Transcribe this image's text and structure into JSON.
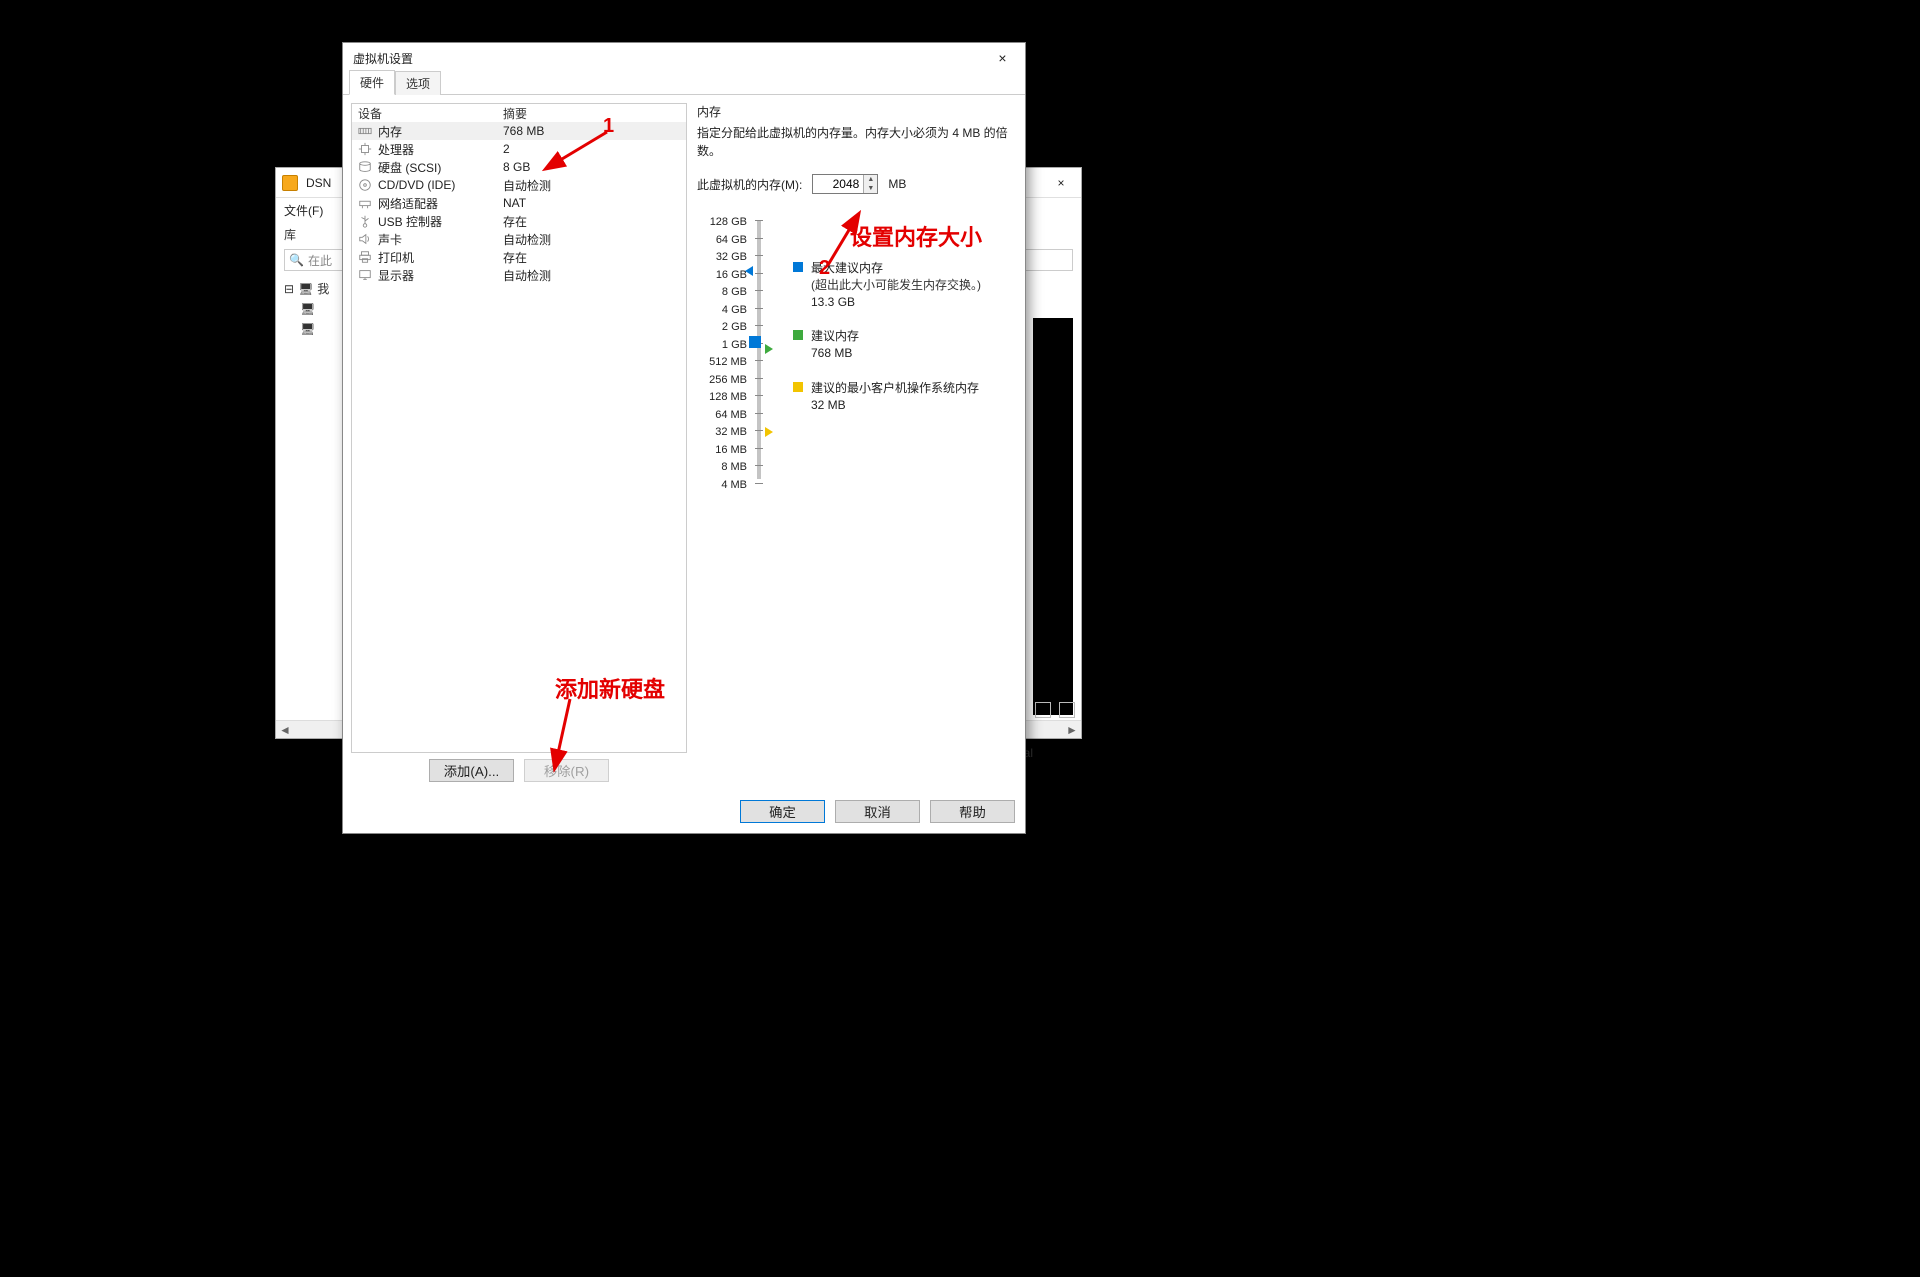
{
  "bg": {
    "title": "DSN",
    "file_menu": "文件(F)",
    "library_label": "库",
    "search_placeholder": "在此",
    "tree_root": "我",
    "al_text": "al",
    "win_minimize": "—",
    "win_maximize": "□",
    "win_close": "×"
  },
  "dialog": {
    "title": "虚拟机设置",
    "close": "×",
    "tabs": {
      "hardware": "硬件",
      "options": "选项"
    },
    "columns": {
      "device": "设备",
      "summary": "摘要"
    },
    "devices": [
      {
        "icon": "memory-icon",
        "name": "内存",
        "summary": "768 MB",
        "selected": true
      },
      {
        "icon": "cpu-icon",
        "name": "处理器",
        "summary": "2"
      },
      {
        "icon": "hdd-icon",
        "name": "硬盘 (SCSI)",
        "summary": "8 GB"
      },
      {
        "icon": "cd-icon",
        "name": "CD/DVD (IDE)",
        "summary": "自动检测"
      },
      {
        "icon": "net-icon",
        "name": "网络适配器",
        "summary": "NAT"
      },
      {
        "icon": "usb-icon",
        "name": "USB 控制器",
        "summary": "存在"
      },
      {
        "icon": "sound-icon",
        "name": "声卡",
        "summary": "自动检测"
      },
      {
        "icon": "printer-icon",
        "name": "打印机",
        "summary": "存在"
      },
      {
        "icon": "display-icon",
        "name": "显示器",
        "summary": "自动检测"
      }
    ],
    "add_btn": "添加(A)...",
    "remove_btn": "移除(R)",
    "ok_btn": "确定",
    "cancel_btn": "取消",
    "help_btn": "帮助"
  },
  "memory": {
    "section_title": "内存",
    "desc": "指定分配给此虚拟机的内存量。内存大小必须为 4 MB 的倍数。",
    "label": "此虚拟机的内存(M):",
    "value": "2048",
    "unit": "MB",
    "ticks": [
      "128 GB",
      "64 GB",
      "32 GB",
      "16 GB",
      "8 GB",
      "4 GB",
      "2 GB",
      "1 GB",
      "512 MB",
      "256 MB",
      "128 MB",
      "64 MB",
      "32 MB",
      "16 MB",
      "8 MB",
      "4 MB"
    ],
    "legend": {
      "max": {
        "title": "最大建议内存",
        "note": "(超出此大小可能发生内存交换。)",
        "value": "13.3 GB"
      },
      "rec": {
        "title": "建议内存",
        "value": "768 MB"
      },
      "min": {
        "title": "建议的最小客户机操作系统内存",
        "value": "32 MB"
      }
    }
  },
  "annotations": {
    "one": "1",
    "two": "2",
    "set_mem": "设置内存大小",
    "add_disk": "添加新硬盘"
  }
}
